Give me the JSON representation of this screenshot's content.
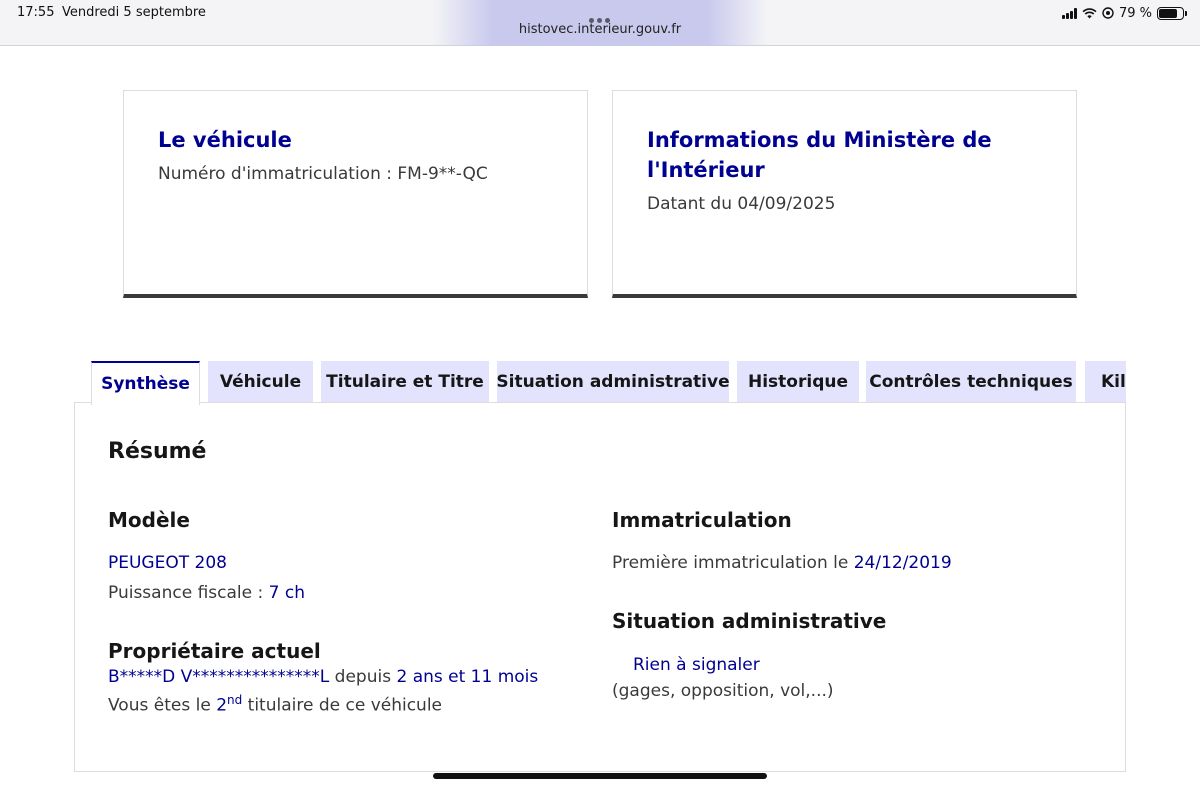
{
  "status_bar": {
    "time": "17:55",
    "date": "Vendredi 5 septembre",
    "url": "histovec.interieur.gouv.fr",
    "battery": "79 %",
    "battery_level_percent": 79
  },
  "cards": {
    "vehicle": {
      "title": "Le véhicule",
      "plate_line": "Numéro d'immatriculation : FM-9**-QC"
    },
    "ministry": {
      "title_line1": "Informations du Ministère de",
      "title_line2": "l'Intérieur",
      "date_line": "Datant du 04/09/2025"
    }
  },
  "tabs": [
    {
      "label": "Synthèse",
      "active": true
    },
    {
      "label": "Véhicule",
      "active": false
    },
    {
      "label": "Titulaire et Titre",
      "active": false
    },
    {
      "label": "Situation administrative",
      "active": false
    },
    {
      "label": "Historique",
      "active": false
    },
    {
      "label": "Contrôles techniques",
      "active": false
    },
    {
      "label": "Kil",
      "active": false
    }
  ],
  "summary": {
    "heading": "Résumé",
    "model": {
      "heading": "Modèle",
      "name": "PEUGEOT 208",
      "power_label": "Puissance fiscale : ",
      "power_value": "7 ch"
    },
    "owner": {
      "heading": "Propriétaire actuel",
      "name": "B*****D V***************L",
      "since_label": " depuis ",
      "since_value": "2 ans et 11 mois",
      "rank_prefix": "Vous êtes le ",
      "rank_value": "2",
      "rank_sup": "nd",
      "rank_suffix": " titulaire de ce véhicule"
    },
    "registration": {
      "heading": "Immatriculation",
      "first_label": "Première immatriculation le ",
      "first_date": "24/12/2019"
    },
    "admin": {
      "heading": "Situation administrative",
      "status": "Rien à signaler",
      "detail": "(gages, opposition, vol,...)"
    }
  }
}
